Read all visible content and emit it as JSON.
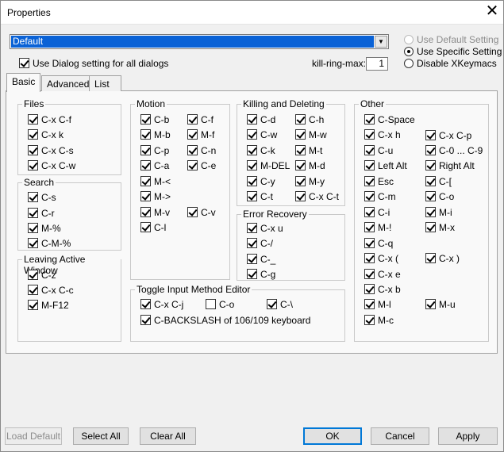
{
  "window": {
    "title": "Properties",
    "close_glyph": "✕"
  },
  "profile": {
    "value": "Default",
    "arrow": "▼"
  },
  "dialog_setting": {
    "label": "Use Dialog setting for all dialogs",
    "checked": true
  },
  "setting_mode": {
    "options": [
      {
        "label": "Use Default Setting",
        "disabled": true,
        "selected": false
      },
      {
        "label": "Use Specific Setting",
        "disabled": false,
        "selected": true
      },
      {
        "label": "Disable XKeymacs",
        "disabled": false,
        "selected": false
      }
    ]
  },
  "kill_ring": {
    "label": "kill-ring-max:",
    "value": "1"
  },
  "tabs": [
    {
      "label": "Basic",
      "active": true
    },
    {
      "label": "Advanced",
      "active": false
    },
    {
      "label": "List",
      "active": false
    }
  ],
  "groups": {
    "files": {
      "title": "Files",
      "items": [
        {
          "label": "C-x C-f",
          "checked": true
        },
        {
          "label": "C-x k",
          "checked": true
        },
        {
          "label": "C-x C-s",
          "checked": true
        },
        {
          "label": "C-x C-w",
          "checked": true
        }
      ]
    },
    "search": {
      "title": "Search",
      "items": [
        {
          "label": "C-s",
          "checked": true
        },
        {
          "label": "C-r",
          "checked": true
        },
        {
          "label": "M-%",
          "checked": true
        },
        {
          "label": "C-M-%",
          "checked": true
        }
      ]
    },
    "leaving": {
      "title": "Leaving Active Window",
      "items": [
        {
          "label": "C-z",
          "checked": true
        },
        {
          "label": "C-x C-c",
          "checked": true
        },
        {
          "label": "M-F12",
          "checked": true
        }
      ]
    },
    "motion": {
      "title": "Motion",
      "items": [
        {
          "label": "C-b",
          "checked": true
        },
        {
          "label": "C-f",
          "checked": true
        },
        {
          "label": "M-b",
          "checked": true
        },
        {
          "label": "M-f",
          "checked": true
        },
        {
          "label": "C-p",
          "checked": true
        },
        {
          "label": "C-n",
          "checked": true
        },
        {
          "label": "C-a",
          "checked": true
        },
        {
          "label": "C-e",
          "checked": true
        },
        {
          "label": "M-<",
          "checked": true
        },
        {
          "label": "M->",
          "checked": true
        },
        {
          "label": "M-v",
          "checked": true
        },
        {
          "label": "C-v",
          "checked": true
        },
        {
          "label": "C-l",
          "checked": true
        }
      ]
    },
    "killing": {
      "title": "Killing and Deleting",
      "items": [
        {
          "label": "C-d",
          "checked": true
        },
        {
          "label": "C-h",
          "checked": true
        },
        {
          "label": "C-w",
          "checked": true
        },
        {
          "label": "M-w",
          "checked": true
        },
        {
          "label": "C-k",
          "checked": true
        },
        {
          "label": "M-t",
          "checked": true
        },
        {
          "label": "M-DEL",
          "checked": true
        },
        {
          "label": "M-d",
          "checked": true
        },
        {
          "label": "C-y",
          "checked": true
        },
        {
          "label": "M-y",
          "checked": true
        },
        {
          "label": "C-t",
          "checked": true
        },
        {
          "label": "C-x C-t",
          "checked": true
        }
      ]
    },
    "error": {
      "title": "Error Recovery",
      "items": [
        {
          "label": "C-x u",
          "checked": true
        },
        {
          "label": "C-/",
          "checked": true
        },
        {
          "label": "C-_",
          "checked": true
        },
        {
          "label": "C-g",
          "checked": true
        }
      ]
    },
    "ime": {
      "title": "Toggle Input Method Editor",
      "items": [
        {
          "label": "C-x C-j",
          "checked": true
        },
        {
          "label": "C-o",
          "checked": false
        },
        {
          "label": "C-\\",
          "checked": true
        },
        {
          "label": "C-BACKSLASH of 106/109 keyboard",
          "checked": true
        }
      ]
    },
    "other": {
      "title": "Other",
      "items": [
        {
          "label": "C-Space",
          "checked": true
        },
        {
          "label": "C-x h",
          "checked": true
        },
        {
          "label": "C-x C-p",
          "checked": true
        },
        {
          "label": "C-u",
          "checked": true
        },
        {
          "label": "C-0 ... C-9",
          "checked": true
        },
        {
          "label": "Left Alt",
          "checked": true
        },
        {
          "label": "Right Alt",
          "checked": true
        },
        {
          "label": "Esc",
          "checked": true
        },
        {
          "label": "C-[",
          "checked": true
        },
        {
          "label": "C-m",
          "checked": true
        },
        {
          "label": "C-o",
          "checked": true
        },
        {
          "label": "C-i",
          "checked": true
        },
        {
          "label": "M-i",
          "checked": true
        },
        {
          "label": "M-!",
          "checked": true
        },
        {
          "label": "M-x",
          "checked": true
        },
        {
          "label": "C-q",
          "checked": true
        },
        {
          "label": "C-x (",
          "checked": true
        },
        {
          "label": "C-x )",
          "checked": true
        },
        {
          "label": "C-x e",
          "checked": true
        },
        {
          "label": "C-x b",
          "checked": true
        },
        {
          "label": "M-l",
          "checked": true
        },
        {
          "label": "M-u",
          "checked": true
        },
        {
          "label": "M-c",
          "checked": true
        }
      ]
    }
  },
  "buttons": {
    "load_default": "Load Default",
    "select_all": "Select All",
    "clear_all": "Clear All",
    "ok": "OK",
    "cancel": "Cancel",
    "apply": "Apply"
  }
}
